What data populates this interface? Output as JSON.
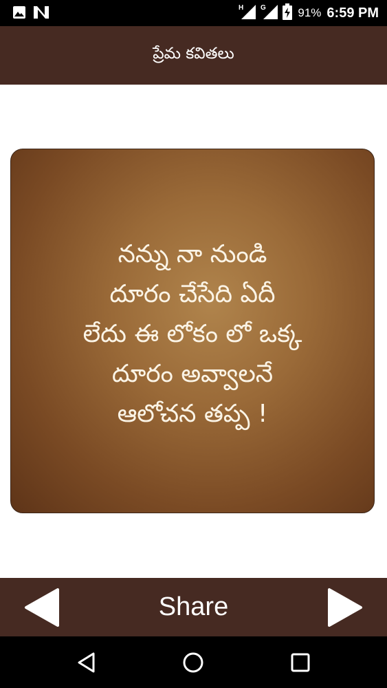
{
  "status_bar": {
    "left_icons": [
      "gallery-icon",
      "n-notification-icon"
    ],
    "signal_labels": [
      "H",
      "G"
    ],
    "battery_percent": "91%",
    "time": "6:59 PM"
  },
  "app_bar": {
    "title": "ప్రేమ కవితలు"
  },
  "quote": {
    "lines": [
      "నన్ను నా నుండి",
      "దూరం చేసేది ఏదీ",
      "లేదు ఈ లోకం లో ఒక్క",
      "దూరం అవ్వాలనే",
      "ఆలోచన తప్ప !"
    ]
  },
  "bottom_bar": {
    "prev_icon": "left-triangle-icon",
    "share_label": "Share",
    "next_icon": "right-triangle-icon"
  },
  "nav_bar": {
    "icons": [
      "back-icon",
      "home-icon",
      "recents-icon"
    ]
  },
  "colors": {
    "bar_brown": "#462a22",
    "card_center": "#b0844c",
    "card_edge": "#5e3418",
    "text_light": "#fbf4e6"
  }
}
